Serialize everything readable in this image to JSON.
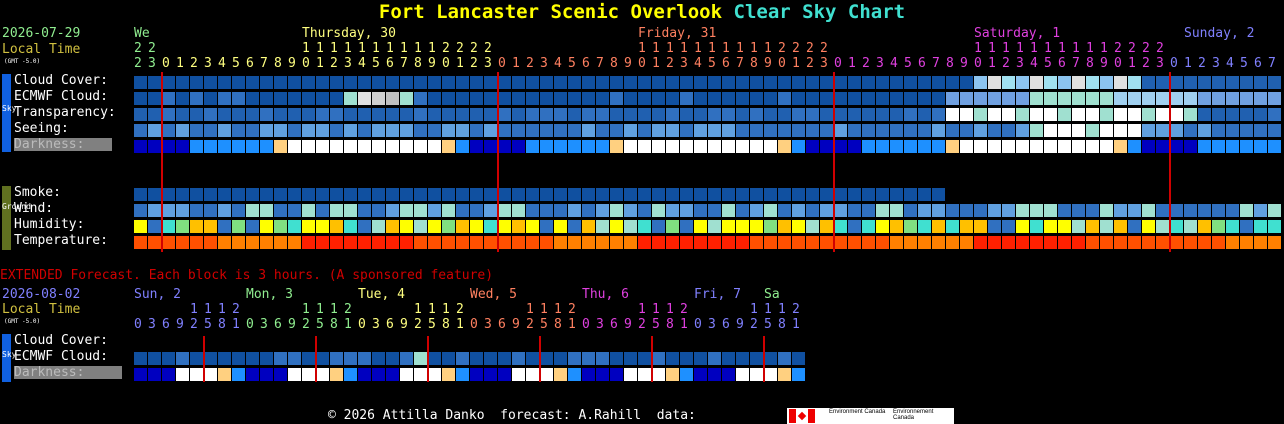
{
  "title": {
    "prefix": "Fort Lancaster Scenic Overlook",
    "suffix": "Clear Sky Chart"
  },
  "main": {
    "date": "2026-07-29",
    "local_time": "Local Time",
    "gmt": "(GMT -5.0)",
    "days": [
      {
        "label": "We",
        "color": "#90ee90"
      },
      {
        "label": "Thursday, 30",
        "color": "#ffff80"
      },
      {
        "label": "Friday, 31",
        "color": "#ff8060"
      },
      {
        "label": "Saturday, 1",
        "color": "#e040e0"
      },
      {
        "label": "Sunday, 2",
        "color": "#8080ff"
      }
    ],
    "labels": {
      "cloud": "Cloud Cover:",
      "ecmwf": "ECMWF Cloud:",
      "transp": "Transparency:",
      "seeing": "Seeing:",
      "darkness": "Darkness:",
      "smoke": "Smoke:",
      "wind": "Wind:",
      "humidity": "Humidity:",
      "temperature": "Temperature:"
    }
  },
  "extended": {
    "notice": "EXTENDED Forecast. Each block is 3 hours. (A sponsored feature)",
    "date": "2026-08-02",
    "local_time": "Local Time",
    "gmt": "(GMT -5.0)",
    "days": [
      {
        "label": "Sun, 2",
        "color": "#8080ff"
      },
      {
        "label": "Mon, 3",
        "color": "#90ee90"
      },
      {
        "label": "Tue, 4",
        "color": "#ffff80"
      },
      {
        "label": "Wed, 5",
        "color": "#ff8060"
      },
      {
        "label": "Thu, 6",
        "color": "#e040e0"
      },
      {
        "label": "Fri, 7",
        "color": "#8080ff"
      },
      {
        "label": "Sa",
        "color": "#90ee90"
      }
    ],
    "labels": {
      "cloud": "Cloud Cover:",
      "ecmwf": "ECMWF Cloud:",
      "darkness": "Darkness:"
    }
  },
  "sidebar": {
    "sky": "Sky",
    "ground": "Ground"
  },
  "footer": {
    "text": "© 2026 Attilla Danko  forecast: A.Rahill  data:",
    "logo_text": [
      "Environment Canada",
      "Environnement Canada"
    ]
  },
  "colors": {
    "title": "#ffff00",
    "accent": "#40e0d0",
    "vline": "#d00000",
    "ext_notice": "#d00000"
  }
}
